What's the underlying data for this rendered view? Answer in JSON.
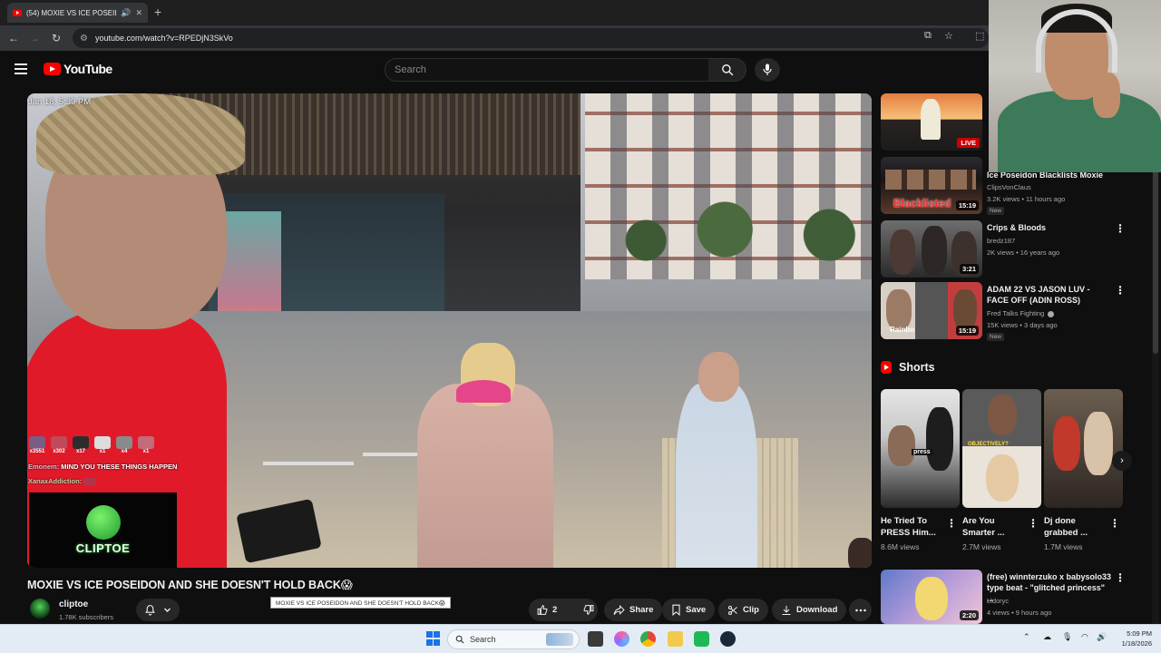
{
  "browser": {
    "tab_title": "(54) MOXIE VS ICE POSEIDO",
    "url": "youtube.com/watch?v=RPEDjN3SkVo"
  },
  "youtube": {
    "search_placeholder": "Search",
    "logo_text": "YouTube"
  },
  "video": {
    "overlay_date": "Jan 18, 5:39 PM",
    "chat_emotes": [
      {
        "count": "x3551"
      },
      {
        "count": "x302"
      },
      {
        "count": "x17"
      },
      {
        "count": "x1"
      },
      {
        "count": "x4"
      },
      {
        "count": "x1"
      }
    ],
    "chat_lines": [
      {
        "user": "Emonem:",
        "text": "MIND YOU THESE THINGS HAPPEN"
      },
      {
        "user": "XanaxAddiction:",
        "text": ""
      }
    ],
    "overlay_logo_text": "CLIPTOE",
    "title": "MOXIE VS ICE POSEIDON AND SHE DOESN'T HOLD BACK😱",
    "tooltip": "MOXIE VS ICE POSEIDON AND SHE DOESN'T HOLD BACK😱",
    "channel_name": "cliptoe",
    "subscribers": "1.78K subscribers",
    "like_count": "2",
    "actions": {
      "share": "Share",
      "save": "Save",
      "clip": "Clip",
      "download": "Download"
    }
  },
  "sidebar": {
    "recommendations": [
      {
        "title": "",
        "channel": "",
        "meta": "",
        "badge": "",
        "duration": "LIVE",
        "is_live": true
      },
      {
        "title": "Ice Poseidon Blacklists Moxie",
        "channel": "ClipsVonClaus",
        "meta": "3.2K views • 11 hours ago",
        "badge": "New",
        "duration": "15:19",
        "thumb_text": "Blacklisted"
      },
      {
        "title": "Crips & Bloods",
        "channel": "bredz187",
        "meta": "2K views • 16 years ago",
        "badge": "",
        "duration": "3:21"
      },
      {
        "title": "ADAM 22 VS JASON LUV - FACE OFF (ADIN ROSS)",
        "channel": "Fred Talks Fighting",
        "meta": "15K views • 3 days ago",
        "badge": "New",
        "duration": "15:19",
        "thumb_text": "Rainbo"
      }
    ],
    "shorts_label": "Shorts",
    "shorts": [
      {
        "title": "He Tried To PRESS Him...",
        "views": "8.6M views",
        "thumb_text": "press"
      },
      {
        "title": "Are You Smarter ...",
        "views": "2.7M views",
        "thumb_text": "OBJECTIVELY?"
      },
      {
        "title": "Dj done grabbed ...",
        "views": "1.7M views"
      }
    ],
    "bottom_rec": {
      "title": "(free) winnterzuko x babysolo33 type beat - \"glitched princess\" ...",
      "channel": "Lldoryc",
      "meta": "4 views • 9 hours ago",
      "duration": "2:20"
    }
  },
  "taskbar": {
    "search_label": "Search",
    "time": "5:09 PM",
    "date": "1/18/2026"
  },
  "colors": {
    "background": "#0f0f0f",
    "youtube_red": "#ff0000",
    "text_primary": "#f1f1f1",
    "text_secondary": "#aaaaaa",
    "taskbar": "#e3ecf5"
  }
}
